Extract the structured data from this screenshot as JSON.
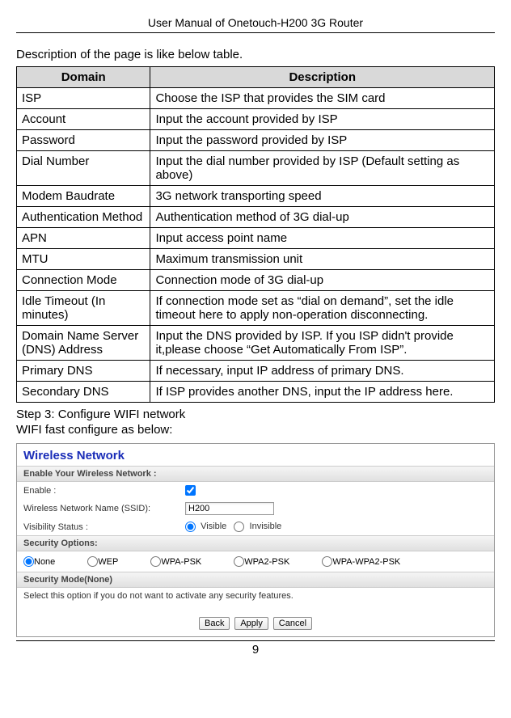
{
  "header": {
    "title": "User Manual of Onetouch-H200 3G Router"
  },
  "intro": "Description of the page is like below table.",
  "table": {
    "headers": [
      "Domain",
      "Description"
    ],
    "rows": [
      {
        "domain": "ISP",
        "desc": "Choose the ISP that provides the SIM card"
      },
      {
        "domain": "Account",
        "desc": "Input the account provided by ISP"
      },
      {
        "domain": "Password",
        "desc": "Input the password provided by ISP"
      },
      {
        "domain": "Dial Number",
        "desc": "Input the dial number provided by ISP (Default setting as above)"
      },
      {
        "domain": "Modem Baudrate",
        "desc": "3G network transporting speed"
      },
      {
        "domain": "Authentication Method",
        "desc": "Authentication method of 3G dial-up"
      },
      {
        "domain": "APN",
        "desc": "Input access point name"
      },
      {
        "domain": "MTU",
        "desc": "Maximum transmission unit"
      },
      {
        "domain": "Connection Mode",
        "desc": "Connection mode of 3G dial-up"
      },
      {
        "domain": "Idle Timeout (In minutes)",
        "desc": "If connection mode set as “dial on demand”, set the idle timeout here to apply non-operation disconnecting."
      },
      {
        "domain": "Domain Name Server (DNS) Address",
        "desc": "Input the DNS provided by ISP. If you ISP didn't provide it,please choose “Get Automatically From ISP”."
      },
      {
        "domain": "Primary DNS",
        "desc": "If necessary, input IP address of primary DNS."
      },
      {
        "domain": "Secondary DNS",
        "desc": "If ISP provides another DNS, input the IP address here."
      }
    ]
  },
  "step3": "Step 3: Configure WIFI network",
  "wifi_intro": "WIFI fast configure as below:",
  "wifi": {
    "heading": "Wireless Network",
    "section_enable": "Enable Your Wireless Network :",
    "enable_label": "Enable :",
    "ssid_label": "Wireless Network Name (SSID):",
    "ssid_value": "H200",
    "visibility_label": "Visibility Status :",
    "visibility_visible": "Visible",
    "visibility_invisible": "Invisible",
    "section_security": "Security Options:",
    "opt_none": "None",
    "opt_wep": "WEP",
    "opt_wpapsk": "WPA-PSK",
    "opt_wpa2psk": "WPA2-PSK",
    "opt_wpawpa2psk": "WPA-WPA2-PSK",
    "section_mode": "Security Mode(None)",
    "security_note": "Select this option if you do not want to activate any security features.",
    "btn_back": "Back",
    "btn_apply": "Apply",
    "btn_cancel": "Cancel"
  },
  "page_number": "9"
}
